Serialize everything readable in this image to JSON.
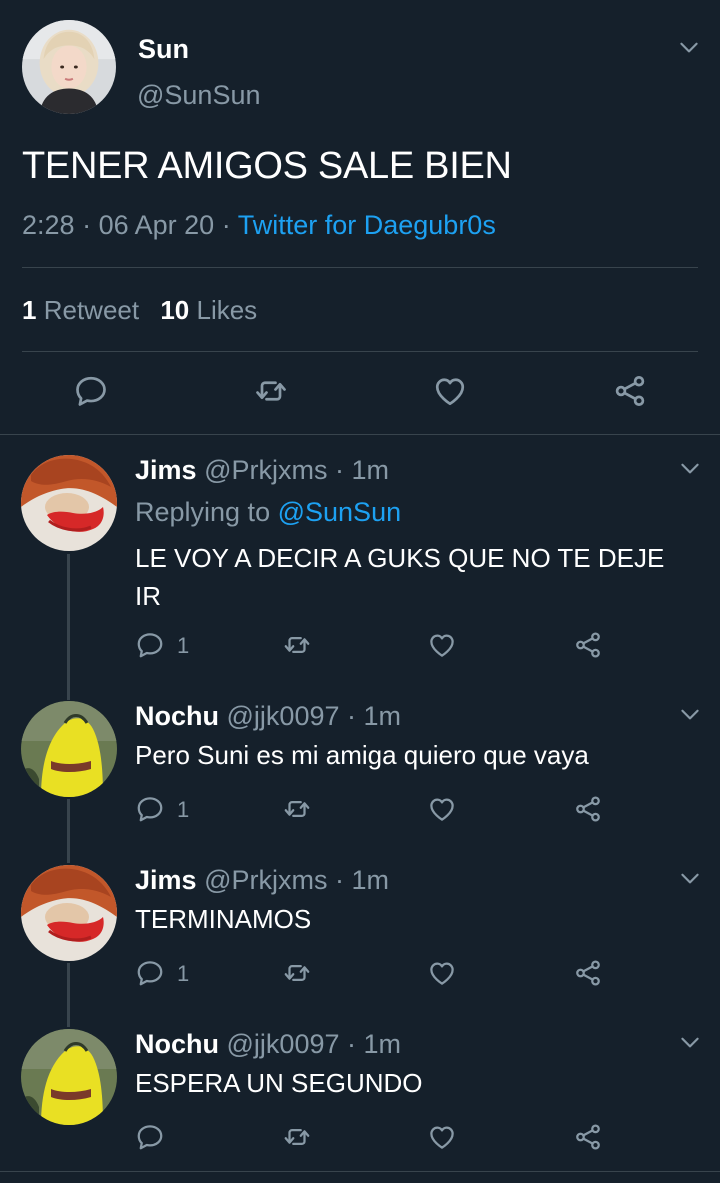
{
  "main_tweet": {
    "display_name": "Sun",
    "handle": "@SunSun",
    "text": "TENER AMIGOS SALE BIEN",
    "time": "2:28",
    "date": "06 Apr 20",
    "sep1": "·",
    "sep2": "·",
    "source": "Twitter for Daegubr0s",
    "retweets_count": "1",
    "retweets_label": "Retweet",
    "likes_count": "10",
    "likes_label": "Likes"
  },
  "replies": [
    {
      "display_name": "Jims",
      "handle": "@Prkjxms",
      "sep": "·",
      "time": "1m",
      "replying_prefix": "Replying to",
      "replying_to": "@SunSun",
      "text_line1": "LE VOY A DECIR A GUKS QUE NO TE DEJE",
      "text_line2": "IR",
      "reply_count": "1"
    },
    {
      "display_name": "Nochu",
      "handle": "@jjk0097",
      "sep": "·",
      "time": "1m",
      "text": "Pero Suni es mi amiga quiero que vaya",
      "reply_count": "1"
    },
    {
      "display_name": "Jims",
      "handle": "@Prkjxms",
      "sep": "·",
      "time": "1m",
      "text": "TERMINAMOS",
      "reply_count": "1"
    },
    {
      "display_name": "Nochu",
      "handle": "@jjk0097",
      "sep": "·",
      "time": "1m",
      "text": "ESPERA UN SEGUNDO"
    }
  ],
  "colors": {
    "background": "#15202b",
    "divider": "#38444d",
    "muted_text": "#8899a6",
    "link": "#1da1f2"
  },
  "icons": {
    "reply": "reply-icon",
    "retweet": "retweet-icon",
    "like": "heart-icon",
    "share": "share-icon",
    "more": "chevron-down-icon"
  }
}
